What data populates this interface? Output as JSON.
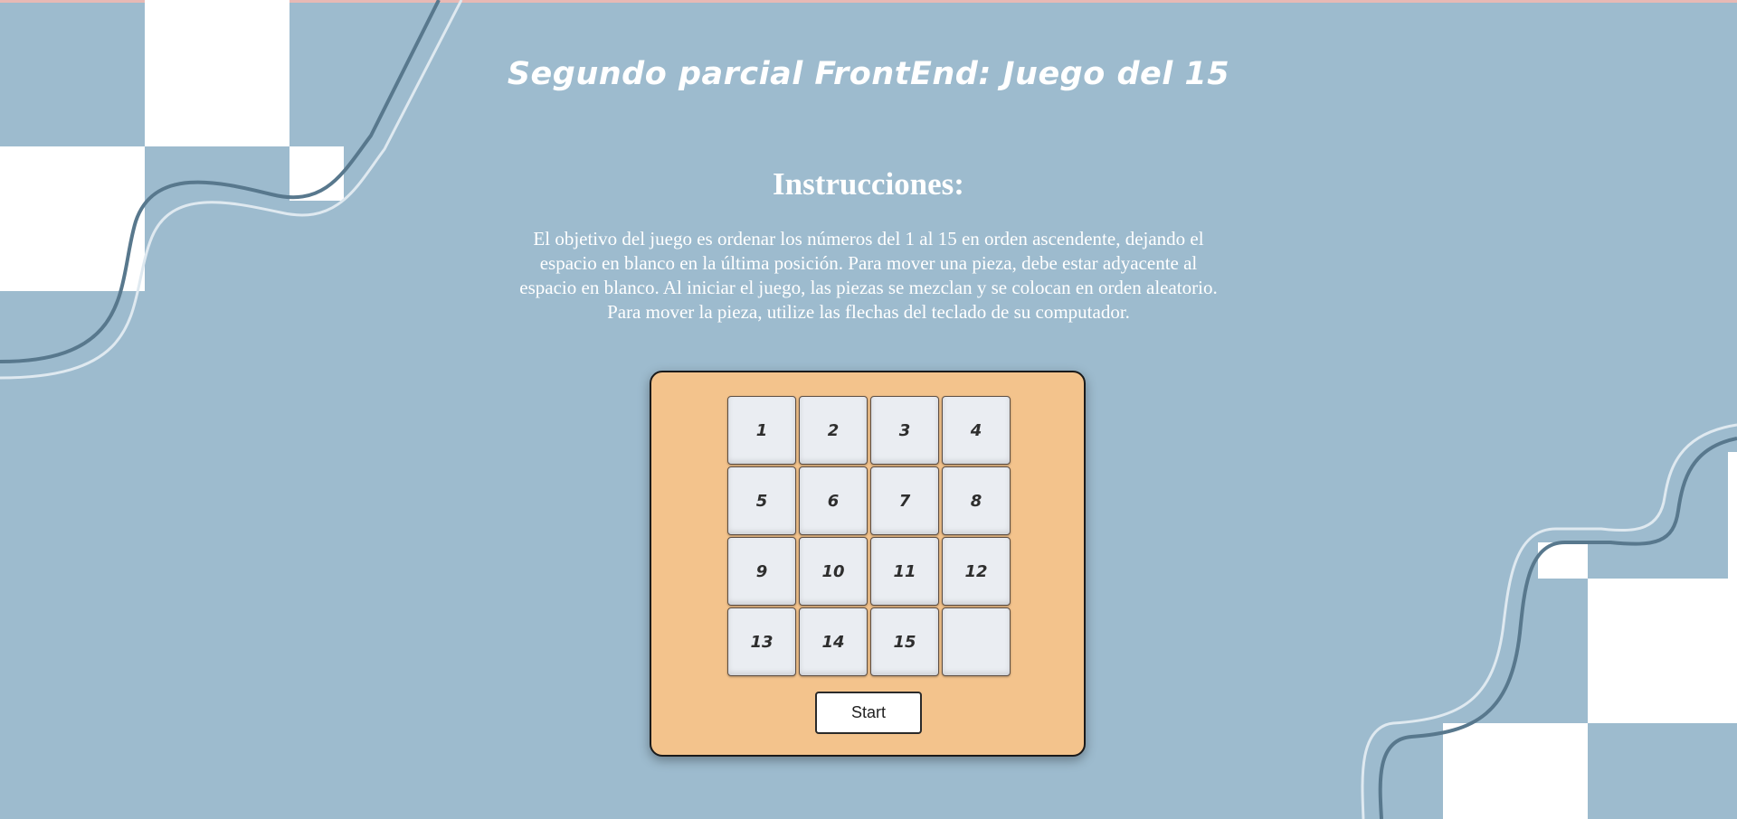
{
  "page": {
    "title": "Segundo parcial FrontEnd: Juego del 15",
    "subtitle": "Instrucciones:",
    "instructions": "El objetivo del juego es ordenar los números del 1 al 15 en orden ascendente, dejando el espacio en blanco en la última posición. Para mover una pieza, debe estar adyacente al espacio en blanco. Al iniciar el juego, las piezas se mezclan y se colocan en orden aleatorio. Para mover la pieza, utilize las flechas del teclado de su computador."
  },
  "board": {
    "tiles": [
      "1",
      "2",
      "3",
      "4",
      "5",
      "6",
      "7",
      "8",
      "9",
      "10",
      "11",
      "12",
      "13",
      "14",
      "15",
      ""
    ],
    "start_label": "Start"
  },
  "colors": {
    "background": "#9dbbce",
    "board": "#f3c38c",
    "tile": "#eaedf2",
    "accent_line": "#5a7a8f"
  }
}
